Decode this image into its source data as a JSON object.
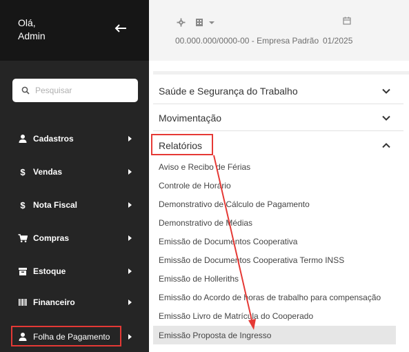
{
  "sidebar": {
    "greeting_line1": "Olá,",
    "greeting_line2": "Admin",
    "search_placeholder": "Pesquisar",
    "items": [
      {
        "label": "Cadastros",
        "icon": "user-icon"
      },
      {
        "label": "Vendas",
        "icon": "dollar-icon"
      },
      {
        "label": "Nota Fiscal",
        "icon": "dollar-icon"
      },
      {
        "label": "Compras",
        "icon": "cart-icon"
      },
      {
        "label": "Estoque",
        "icon": "archive-icon"
      },
      {
        "label": "Financeiro",
        "icon": "barcode-icon"
      },
      {
        "label": "Folha de Pagamento",
        "icon": "user-icon"
      }
    ]
  },
  "topbar": {
    "company": "00.000.000/0000-00 - Empresa Padrão",
    "period": "01/2025"
  },
  "panel": {
    "sections": [
      {
        "title": "Saúde e Segurança do Trabalho"
      },
      {
        "title": "Movimentação"
      },
      {
        "title": "Relatórios"
      }
    ],
    "reports": [
      "Aviso e Recibo de Férias",
      "Controle de Horário",
      "Demonstrativo de Cálculo de Pagamento",
      "Demonstrativo de Médias",
      "Emissão de Documentos Cooperativa",
      "Emissão de Documentos Cooperativa Termo INSS",
      "Emissão de Holleriths",
      "Emissão do Acordo de horas de trabalho para compensação",
      "Emissão Livro de Matrícula do Cooperado",
      "Emissão Proposta de Ingresso"
    ]
  },
  "colors": {
    "sidebar_bg": "#252525",
    "annotation": "#e53935"
  }
}
